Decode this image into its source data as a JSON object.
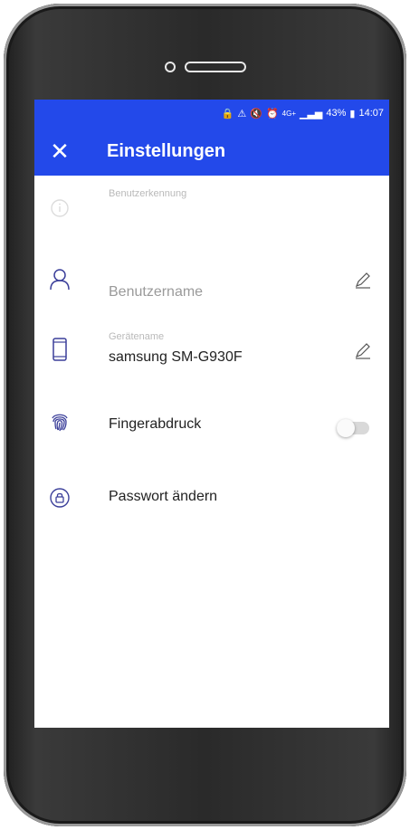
{
  "status": {
    "battery": "43%",
    "time": "14:07",
    "network": "4G+"
  },
  "appbar": {
    "title": "Einstellungen",
    "close_icon": "close-icon"
  },
  "settings": {
    "user_id": {
      "label": "Benutzerkennung",
      "value": ""
    },
    "username": {
      "placeholder": "Benutzername"
    },
    "device": {
      "label": "Gerätename",
      "value": "samsung SM-G930F"
    },
    "fingerprint": {
      "label": "Fingerabdruck",
      "enabled": false
    },
    "password": {
      "label": "Passwort ändern"
    }
  },
  "colors": {
    "accent": "#2349ea"
  }
}
